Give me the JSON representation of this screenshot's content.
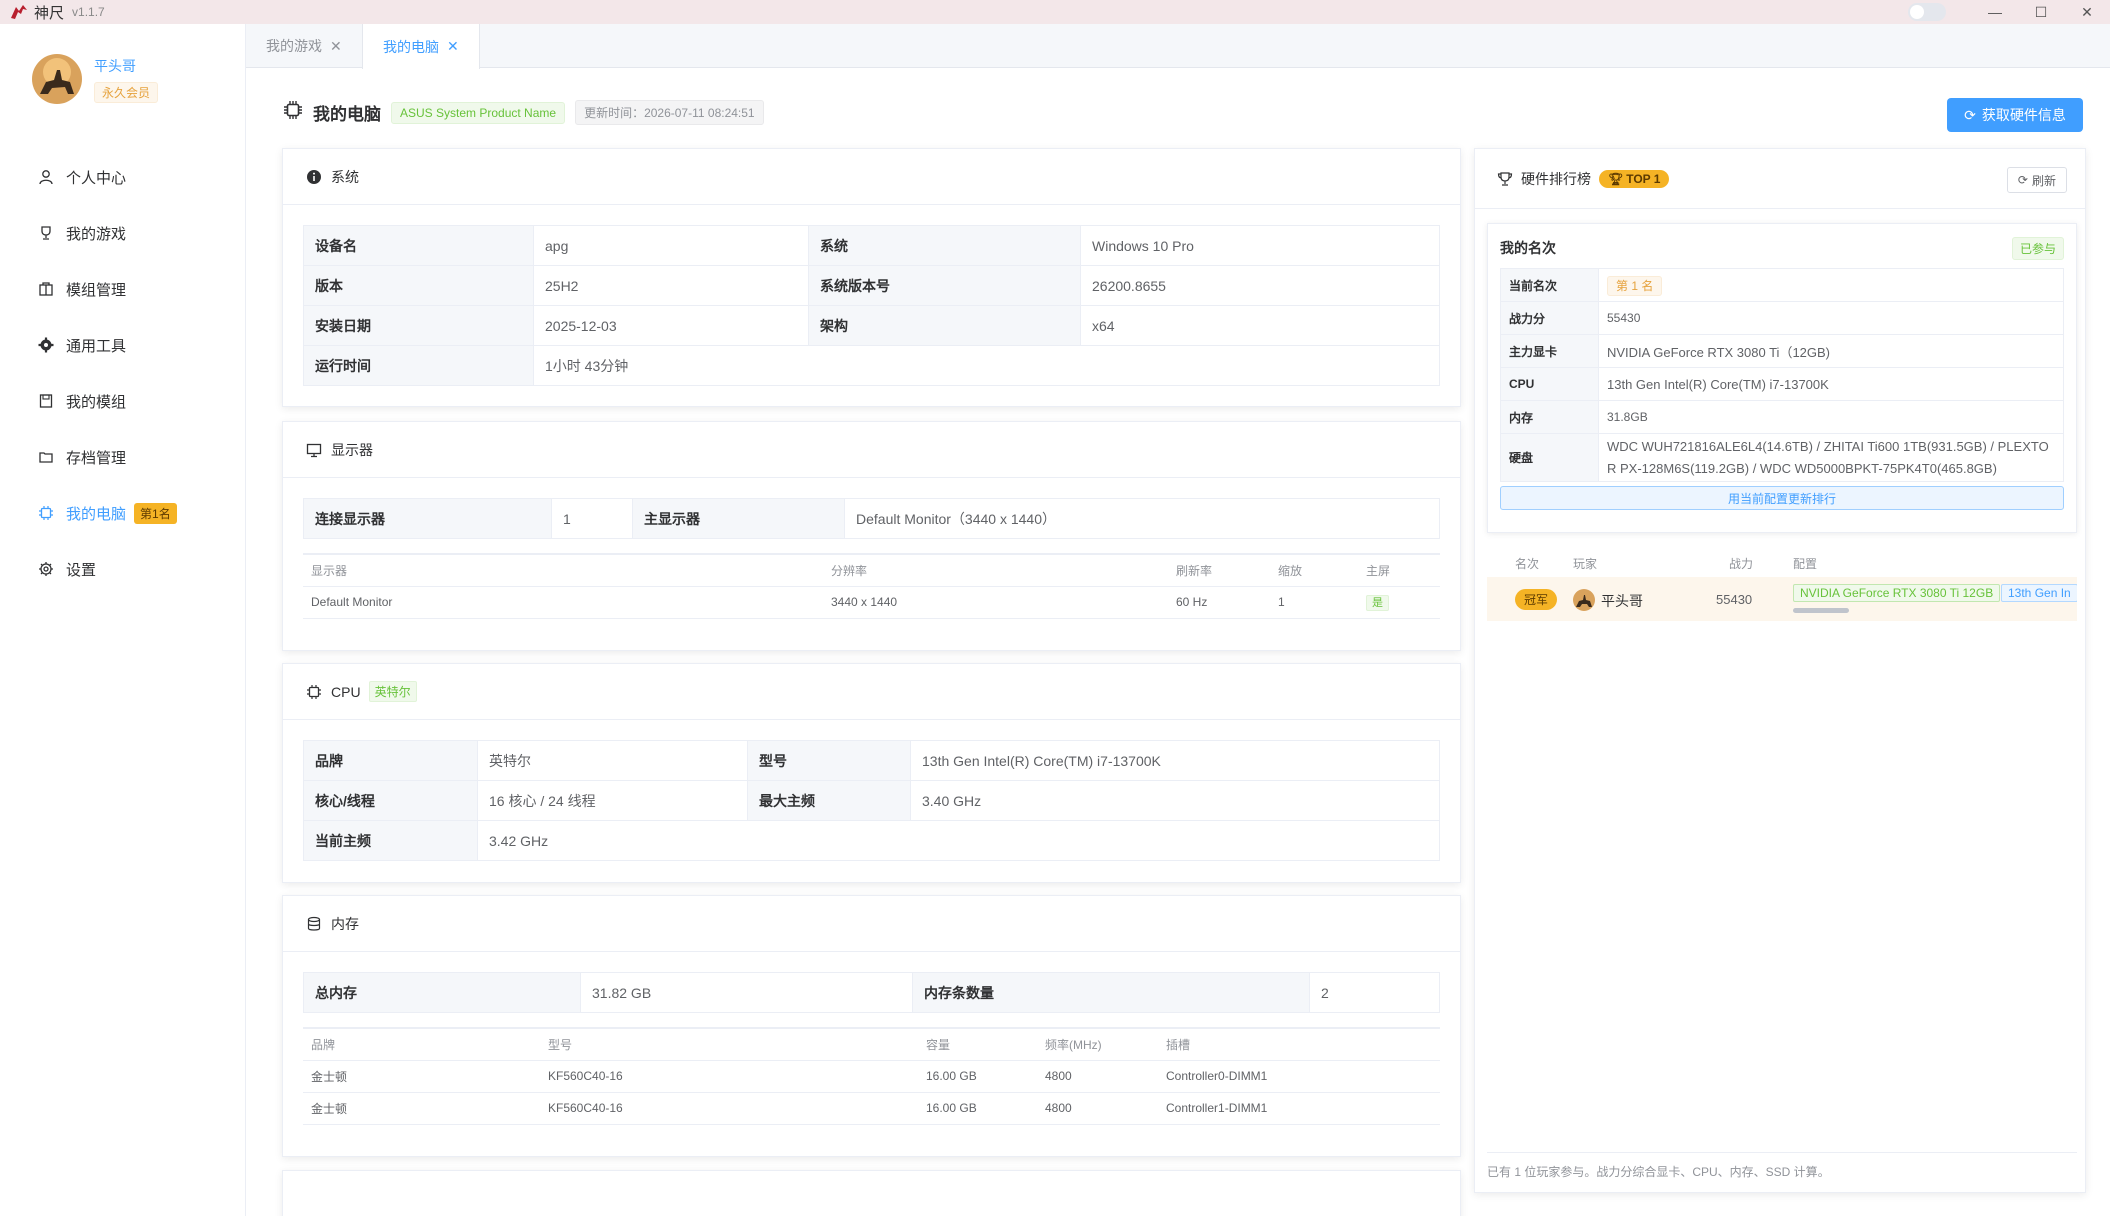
{
  "app": {
    "title": "神尺",
    "version": "v1.1.7"
  },
  "user": {
    "name": "平头哥",
    "membership": "永久会员"
  },
  "nav": [
    {
      "label": "个人中心",
      "icon": "user-icon"
    },
    {
      "label": "我的游戏",
      "icon": "trophy-icon"
    },
    {
      "label": "模组管理",
      "icon": "package-icon"
    },
    {
      "label": "通用工具",
      "icon": "gear-icon"
    },
    {
      "label": "我的模组",
      "icon": "save-icon"
    },
    {
      "label": "存档管理",
      "icon": "folder-icon"
    },
    {
      "label": "我的电脑",
      "icon": "cpu-icon",
      "badge": "第1名",
      "active": true
    },
    {
      "label": "设置",
      "icon": "settings-icon"
    }
  ],
  "tabs": [
    {
      "label": "我的游戏"
    },
    {
      "label": "我的电脑",
      "active": true
    }
  ],
  "page": {
    "title": "我的电脑",
    "product_tag": "ASUS System Product Name",
    "updated": "更新时间：2026-07-11 08:24:51",
    "fetch_button": "获取硬件信息"
  },
  "system": {
    "title": "系统",
    "rows": [
      {
        "l1": "设备名",
        "v1": "apg",
        "l2": "系统",
        "v2": "Windows 10 Pro"
      },
      {
        "l1": "版本",
        "v1": "25H2",
        "l2": "系统版本号",
        "v2": "26200.8655"
      },
      {
        "l1": "安装日期",
        "v1": "2025-12-03",
        "l2": "架构",
        "v2": "x64"
      },
      {
        "l1": "运行时间",
        "v1": "1小时 43分钟"
      }
    ]
  },
  "display": {
    "title": "显示器",
    "connected_label": "连接显示器",
    "connected_value": "1",
    "primary_label": "主显示器",
    "primary_value": "Default Monitor（3440 x 1440）",
    "columns": [
      "显示器",
      "分辨率",
      "刷新率",
      "缩放",
      "主屏"
    ],
    "rows": [
      {
        "name": "Default Monitor",
        "resolution": "3440 x 1440",
        "refresh": "60 Hz",
        "scale": "1",
        "primary": "是"
      }
    ]
  },
  "cpu": {
    "title": "CPU",
    "tag": "英特尔",
    "rows": [
      {
        "l1": "品牌",
        "v1": "英特尔",
        "l2": "型号",
        "v2": "13th Gen Intel(R) Core(TM) i7-13700K"
      },
      {
        "l1": "核心/线程",
        "v1": "16 核心 / 24 线程",
        "l2": "最大主频",
        "v2": "3.40 GHz"
      },
      {
        "l1": "当前主频",
        "v1": "3.42 GHz"
      }
    ]
  },
  "memory": {
    "title": "内存",
    "total_label": "总内存",
    "total_value": "31.82 GB",
    "count_label": "内存条数量",
    "count_value": "2",
    "columns": [
      "品牌",
      "型号",
      "容量",
      "频率(MHz)",
      "插槽"
    ],
    "rows": [
      {
        "brand": "金士顿",
        "model": "KF560C40-16",
        "capacity": "16.00 GB",
        "freq": "4800",
        "slot": "Controller0-DIMM1"
      },
      {
        "brand": "金士顿",
        "model": "KF560C40-16",
        "capacity": "16.00 GB",
        "freq": "4800",
        "slot": "Controller1-DIMM1"
      }
    ]
  },
  "ranking": {
    "title": "硬件排行榜",
    "badge": "TOP 1",
    "refresh": "刷新",
    "my_title": "我的名次",
    "joined": "已参与",
    "my_rows": [
      {
        "label": "当前名次",
        "value": "第 1 名"
      },
      {
        "label": "战力分",
        "value": "55430"
      },
      {
        "label": "主力显卡",
        "value": "NVIDIA GeForce RTX 3080 Ti（12GB)"
      },
      {
        "label": "CPU",
        "value": "13th Gen Intel(R) Core(TM) i7-13700K"
      },
      {
        "label": "内存",
        "value": "31.8GB"
      },
      {
        "label": "硬盘",
        "value": "WDC WUH721816ALE6L4(14.6TB) / ZHITAI Ti600 1TB(931.5GB) / PLEXTOR PX-128M6S(119.2GB) / WDC WD5000BPKT-75PK4T0(465.8GB)"
      }
    ],
    "update_button": "用当前配置更新排行",
    "columns": [
      "名次",
      "玩家",
      "战力",
      "配置"
    ],
    "entries": [
      {
        "rank": "冠军",
        "player": "平头哥",
        "score": "55430",
        "gpu": "NVIDIA GeForce RTX 3080 Ti 12GB",
        "cpu": "13th Gen In"
      }
    ],
    "footnote": "已有 1 位玩家参与。战力分综合显卡、CPU、内存、SSD 计算。"
  }
}
